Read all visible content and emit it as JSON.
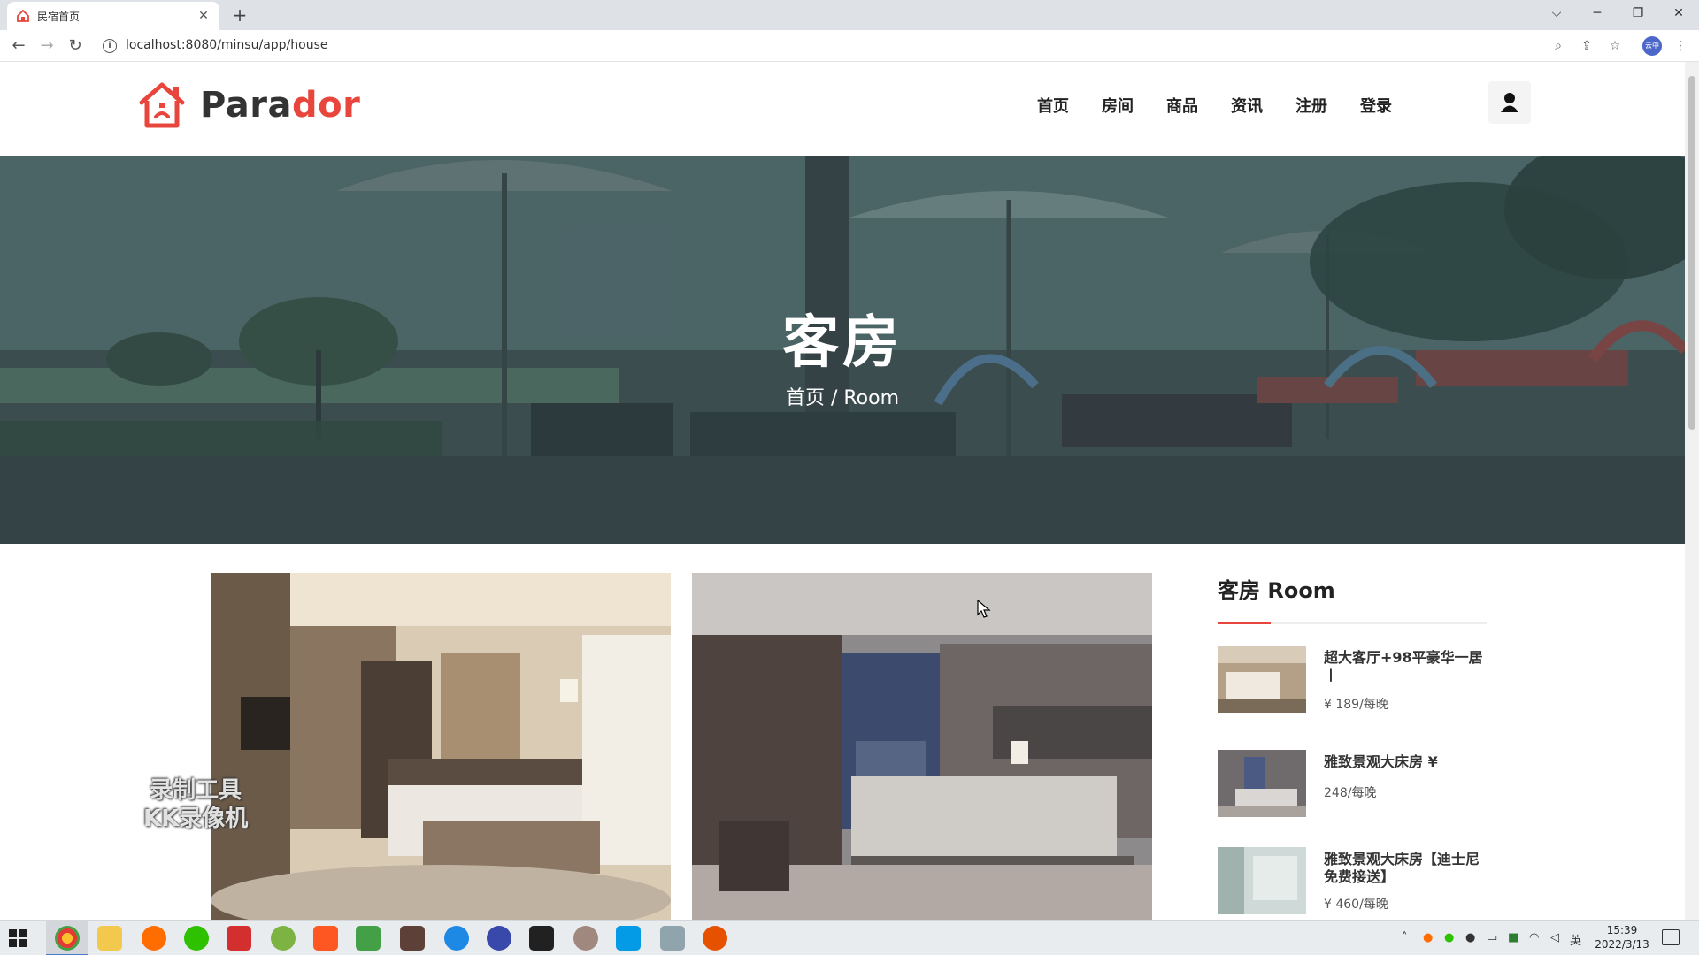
{
  "browser": {
    "tab_title": "民宿首页",
    "url": "localhost:8080/minsu/app/house",
    "profile_label": "云中"
  },
  "site": {
    "logo": {
      "part1": "Para",
      "part2": "dor"
    },
    "nav": [
      "首页",
      "房间",
      "商品",
      "资讯",
      "注册",
      "登录"
    ]
  },
  "hero": {
    "title": "客房",
    "breadcrumb": {
      "home": "首页",
      "separator": " / ",
      "current": "Room"
    }
  },
  "watermark": {
    "line1": "录制工具",
    "line2": "KK录像机"
  },
  "sidebar": {
    "title": "客房 Room",
    "items": [
      {
        "name": "超大客厅+98平豪华一居丨",
        "price": "¥ 189/每晚"
      },
      {
        "name": "雅致景观大床房 ¥",
        "price": "248/每晚"
      },
      {
        "name": "雅致景观大床房【迪士尼免费接送】",
        "price": "¥ 460/每晚"
      }
    ]
  },
  "taskbar": {
    "time": "15:39",
    "date": "2022/3/13",
    "ime": "英"
  },
  "colors": {
    "brand_red": "#e8453c",
    "text_dark": "#222222",
    "taskbar_bg": "#e9ecef"
  }
}
